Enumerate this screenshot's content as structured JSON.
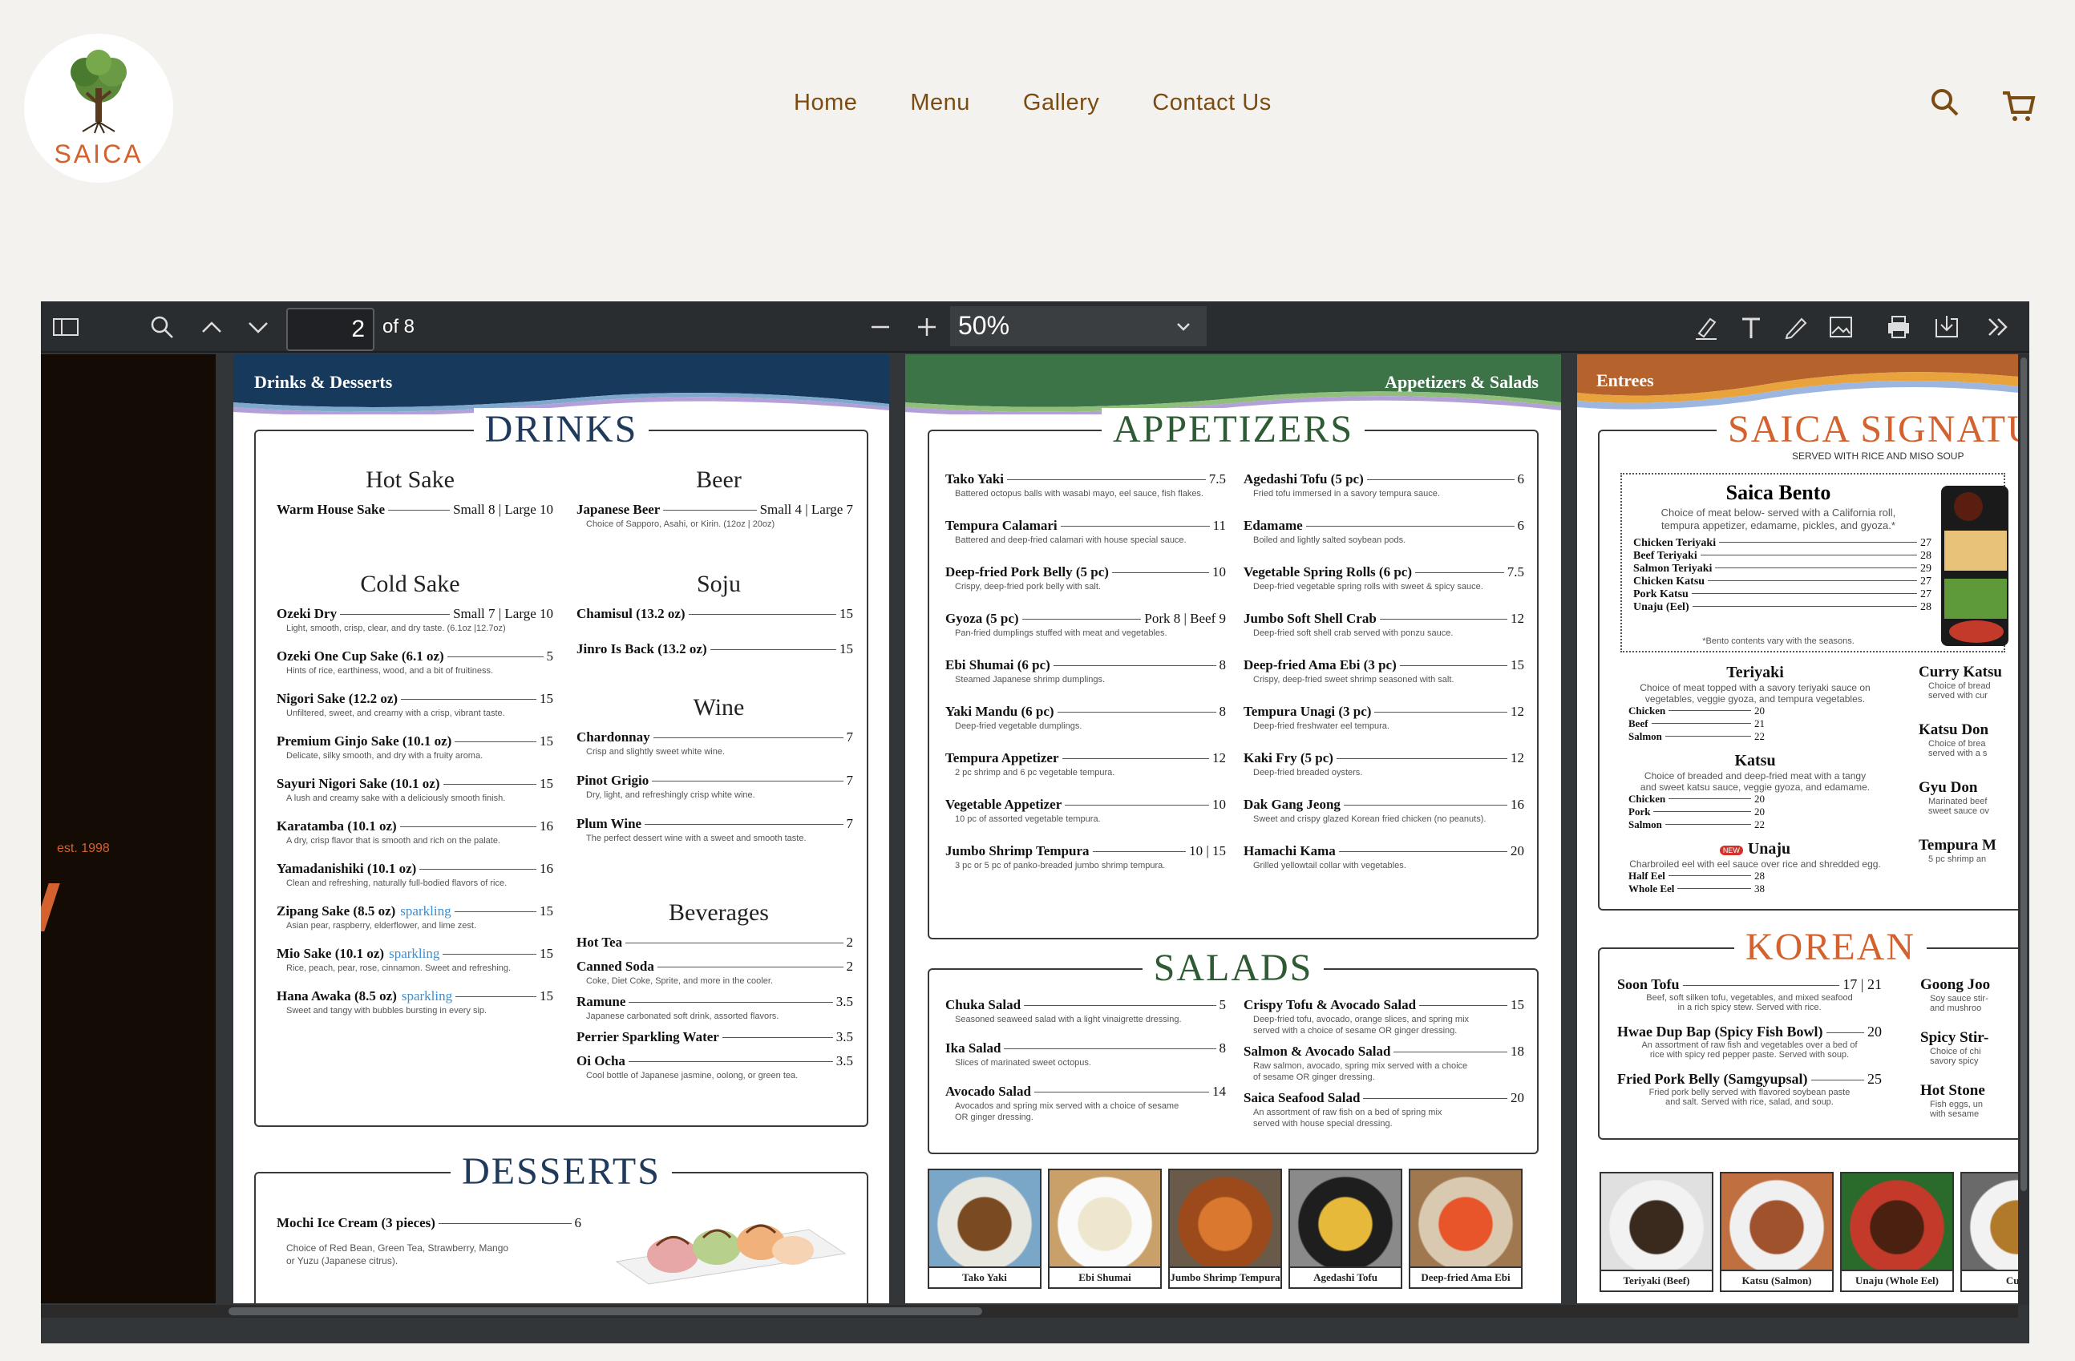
{
  "site": {
    "logo_text": "SAICA",
    "nav": [
      "Home",
      "Menu",
      "Gallery",
      "Contact Us"
    ]
  },
  "toolbar": {
    "page_current": "2",
    "page_of": "of 8",
    "zoom": "50%"
  },
  "cover": {
    "est": "est. 1998"
  },
  "p1": {
    "banner": "Drinks & Desserts",
    "drinks_title": "DRINKS",
    "hot_sake": {
      "title": "Hot Sake",
      "items": [
        {
          "name": "Warm House Sake",
          "price": "Small 8 | Large 10",
          "desc": ""
        }
      ]
    },
    "cold_sake": {
      "title": "Cold Sake",
      "items": [
        {
          "name": "Ozeki Dry",
          "price": "Small 7 | Large 10",
          "desc": "Light, smooth, crisp, clear, and dry taste. (6.1oz |12.7oz)"
        },
        {
          "name": "Ozeki One Cup Sake (6.1 oz)",
          "price": "5",
          "desc": "Hints of rice, earthiness, wood, and a bit of fruitiness."
        },
        {
          "name": "Nigori Sake (12.2 oz)",
          "price": "15",
          "desc": "Unfiltered, sweet, and creamy with a crisp, vibrant taste."
        },
        {
          "name": "Premium Ginjo Sake (10.1 oz)",
          "price": "15",
          "desc": "Delicate, silky smooth, and dry with a fruity aroma."
        },
        {
          "name": "Sayuri Nigori Sake (10.1 oz)",
          "price": "15",
          "desc": "A lush and creamy sake with a deliciously smooth finish."
        },
        {
          "name": "Karatamba (10.1 oz)",
          "price": "16",
          "desc": "A dry, crisp flavor that is smooth and rich on the palate."
        },
        {
          "name": "Yamadanishiki (10.1 oz)",
          "price": "16",
          "desc": "Clean and refreshing, naturally full-bodied flavors of rice."
        },
        {
          "name": "Zipang Sake (8.5 oz)",
          "tag": "sparkling",
          "price": "15",
          "desc": "Asian pear, raspberry, elderflower, and lime zest."
        },
        {
          "name": "Mio Sake (10.1 oz)",
          "tag": "sparkling",
          "price": "15",
          "desc": "Rice, peach, pear, rose, cinnamon. Sweet and refreshing."
        },
        {
          "name": "Hana Awaka (8.5 oz)",
          "tag": "sparkling",
          "price": "15",
          "desc": "Sweet and tangy with bubbles bursting in every sip."
        }
      ]
    },
    "beer": {
      "title": "Beer",
      "items": [
        {
          "name": "Japanese Beer",
          "price": "Small 4 | Large 7",
          "desc": "Choice of Sapporo, Asahi, or Kirin. (12oz | 20oz)"
        }
      ]
    },
    "soju": {
      "title": "Soju",
      "items": [
        {
          "name": "Chamisul (13.2 oz)",
          "price": "15",
          "desc": ""
        },
        {
          "name": "Jinro Is Back (13.2 oz)",
          "price": "15",
          "desc": ""
        }
      ]
    },
    "wine": {
      "title": "Wine",
      "items": [
        {
          "name": "Chardonnay",
          "price": "7",
          "desc": "Crisp and slightly sweet white wine."
        },
        {
          "name": "Pinot Grigio",
          "price": "7",
          "desc": "Dry, light, and refreshingly crisp white wine."
        },
        {
          "name": "Plum Wine",
          "price": "7",
          "desc": "The perfect dessert wine with a sweet and smooth taste."
        }
      ]
    },
    "beverages": {
      "title": "Beverages",
      "items": [
        {
          "name": "Hot Tea",
          "price": "2",
          "desc": ""
        },
        {
          "name": "Canned Soda",
          "price": "2",
          "desc": "Coke, Diet Coke, Sprite, and more in the cooler."
        },
        {
          "name": "Ramune",
          "price": "3.5",
          "desc": "Japanese carbonated soft drink, assorted flavors."
        },
        {
          "name": "Perrier Sparkling Water",
          "price": "3.5",
          "desc": ""
        },
        {
          "name": "Oi Ocha",
          "price": "3.5",
          "desc": "Cool bottle of Japanese jasmine, oolong, or green tea."
        }
      ]
    },
    "desserts_title": "DESSERTS",
    "dessert": {
      "name": "Mochi Ice Cream (3 pieces)",
      "price": "6",
      "desc1": "Choice of Red Bean, Green Tea, Strawberry, Mango",
      "desc2": "or Yuzu (Japanese citrus)."
    }
  },
  "p2": {
    "banner": "Appetizers & Salads",
    "app_title": "APPETIZERS",
    "salads_title": "SALADS",
    "app_left": [
      {
        "name": "Tako Yaki",
        "price": "7.5",
        "desc": "Battered octopus balls with wasabi mayo, eel sauce, fish flakes."
      },
      {
        "name": "Tempura Calamari",
        "price": "11",
        "desc": "Battered and deep-fried calamari with house special sauce."
      },
      {
        "name": "Deep-fried Pork Belly (5 pc)",
        "price": "10",
        "desc": "Crispy, deep-fried pork belly with salt."
      },
      {
        "name": "Gyoza (5 pc)",
        "price": "Pork 8 | Beef 9",
        "desc": "Pan-fried dumplings stuffed with meat and vegetables."
      },
      {
        "name": "Ebi Shumai (6 pc)",
        "price": "8",
        "desc": "Steamed Japanese shrimp dumplings."
      },
      {
        "name": "Yaki Mandu (6 pc)",
        "price": "8",
        "desc": "Deep-fried vegetable dumplings."
      },
      {
        "name": "Tempura Appetizer",
        "price": "12",
        "desc": "2 pc shrimp and 6 pc vegetable tempura."
      },
      {
        "name": "Vegetable Appetizer",
        "price": "10",
        "desc": "10 pc of assorted vegetable tempura."
      },
      {
        "name": "Jumbo Shrimp Tempura",
        "price": "10 | 15",
        "desc": "3 pc or 5 pc of panko-breaded jumbo shrimp tempura."
      }
    ],
    "app_right": [
      {
        "name": "Agedashi Tofu (5 pc)",
        "price": "6",
        "desc": "Fried tofu immersed in a savory tempura sauce."
      },
      {
        "name": "Edamame",
        "price": "6",
        "desc": "Boiled and lightly salted soybean pods."
      },
      {
        "name": "Vegetable Spring Rolls (6 pc)",
        "price": "7.5",
        "desc": "Deep-fried vegetable spring rolls with sweet & spicy sauce."
      },
      {
        "name": "Jumbo Soft Shell Crab",
        "price": "12",
        "desc": "Deep-fried soft shell crab served with ponzu sauce."
      },
      {
        "name": "Deep-fried Ama Ebi (3 pc)",
        "price": "15",
        "desc": "Crispy, deep-fried sweet shrimp seasoned with salt."
      },
      {
        "name": "Tempura Unagi (3 pc)",
        "price": "12",
        "desc": "Deep-fried freshwater eel tempura."
      },
      {
        "name": "Kaki Fry (5 pc)",
        "price": "12",
        "desc": "Deep-fried breaded oysters."
      },
      {
        "name": "Dak Gang Jeong",
        "price": "16",
        "desc": "Sweet and crispy glazed Korean fried chicken (no peanuts)."
      },
      {
        "name": "Hamachi Kama",
        "price": "20",
        "desc": "Grilled yellowtail collar with vegetables."
      }
    ],
    "sal_left": [
      {
        "name": "Chuka Salad",
        "price": "5",
        "desc": "Seasoned seaweed salad with a light vinaigrette dressing.",
        "desc2": ""
      },
      {
        "name": "Ika Salad",
        "price": "8",
        "desc": "Slices of marinated sweet octopus.",
        "desc2": ""
      },
      {
        "name": "Avocado Salad",
        "price": "14",
        "desc": "Avocados and spring mix served with a choice of sesame",
        "desc2": "OR ginger dressing."
      }
    ],
    "sal_right": [
      {
        "name": "Crispy Tofu & Avocado Salad",
        "price": "15",
        "desc": "Deep-fried tofu, avocado, orange slices, and spring mix",
        "desc2": "served with a choice of sesame OR ginger dressing."
      },
      {
        "name": "Salmon & Avocado Salad",
        "price": "18",
        "desc": "Raw salmon, avocado, spring mix served with a choice",
        "desc2": "of sesame OR ginger dressing."
      },
      {
        "name": "Saica Seafood Salad",
        "price": "20",
        "desc": "An assortment of raw fish on a bed of spring mix",
        "desc2": "served with house special dressing."
      }
    ],
    "photos": [
      "Tako Yaki",
      "Ebi Shumai",
      "Jumbo Shrimp Tempura",
      "Agedashi Tofu",
      "Deep-fried Ama Ebi"
    ]
  },
  "p3": {
    "banner": "Entrees",
    "sig_title": "SAICA SIGNATU",
    "sig_sub": "SERVED WITH RICE AND MISO SOUP",
    "bento": {
      "title": "Saica Bento",
      "desc1": "Choice of meat below- served with a California roll,",
      "desc2": "tempura appetizer, edamame, pickles, and gyoza.*",
      "items": [
        {
          "name": "Chicken Teriyaki",
          "price": "27"
        },
        {
          "name": "Beef Teriyaki",
          "price": "28"
        },
        {
          "name": "Salmon Teriyaki",
          "price": "29"
        },
        {
          "name": "Chicken Katsu",
          "price": "27"
        },
        {
          "name": "Pork Katsu",
          "price": "27"
        },
        {
          "name": "Unaju (Eel)",
          "price": "28"
        }
      ],
      "note": "*Bento contents vary with the seasons."
    },
    "teriyaki": {
      "title": "Teriyaki",
      "desc1": "Choice of meat topped with a savory teriyaki sauce on",
      "desc2": "vegetables, veggie gyoza, and tempura vegetables.",
      "items": [
        {
          "name": "Chicken",
          "price": "20"
        },
        {
          "name": "Beef",
          "price": "21"
        },
        {
          "name": "Salmon",
          "price": "22"
        }
      ]
    },
    "katsu": {
      "title": "Katsu",
      "desc1": "Choice of breaded and deep-fried meat with a tangy",
      "desc2": "and sweet katsu sauce, veggie gyoza, and edamame.",
      "items": [
        {
          "name": "Chicken",
          "price": "20"
        },
        {
          "name": "Pork",
          "price": "20"
        },
        {
          "name": "Salmon",
          "price": "22"
        }
      ]
    },
    "unaju": {
      "title": "Unaju",
      "badge": "NEW",
      "desc": "Charbroiled eel with eel sauce over rice and shredded egg.",
      "items": [
        {
          "name": "Half Eel",
          "price": "28"
        },
        {
          "name": "Whole Eel",
          "price": "38"
        }
      ]
    },
    "right_col": [
      {
        "name": "Curry Katsu",
        "desc1": "Choice of bread",
        "desc2": "served with cur"
      },
      {
        "name": "Katsu Don",
        "desc1": "Choice of brea",
        "desc2": "served with a s"
      },
      {
        "name": "Gyu Don",
        "desc1": "Marinated beef",
        "desc2": "sweet sauce ov"
      },
      {
        "name": "Tempura M",
        "desc1": "5 pc shrimp an",
        "desc2": ""
      }
    ],
    "korean_title": "KOREAN",
    "korean_left": [
      {
        "name": "Soon Tofu",
        "price": "17 | 21",
        "desc1": "Beef, soft silken tofu, vegetables, and mixed seafood",
        "desc2": "in a rich spicy stew. Served with rice."
      },
      {
        "name": "Hwae Dup Bap (Spicy Fish Bowl)",
        "price": "20",
        "desc1": "An assortment of raw fish and vegetables over a bed of",
        "desc2": "rice with spicy red pepper paste. Served with soup."
      },
      {
        "name": "Fried Pork Belly (Samgyupsal)",
        "price": "25",
        "desc1": "Fried pork belly served with flavored soybean paste",
        "desc2": "and salt. Served with rice, salad, and soup."
      }
    ],
    "korean_right": [
      {
        "name": "Goong Joo",
        "desc1": "Soy sauce stir-",
        "desc2": "and mushroo"
      },
      {
        "name": "Spicy Stir-",
        "desc1": "Choice of chi",
        "desc2": "savory spicy"
      },
      {
        "name": "Hot Stone",
        "desc1": "Fish eggs, un",
        "desc2": "with sesame"
      }
    ],
    "photos": [
      "Teriyaki (Beef)",
      "Katsu (Salmon)",
      "Unaju (Whole Eel)",
      "Curr"
    ]
  },
  "colors": {
    "nav": "#7a4b12",
    "logo": "#d3622f",
    "drinks_head": "#1f3a5a",
    "appetizers_head": "#2e5a34",
    "signature_head": "#d3622f",
    "sparkling": "#3a8fd6"
  }
}
